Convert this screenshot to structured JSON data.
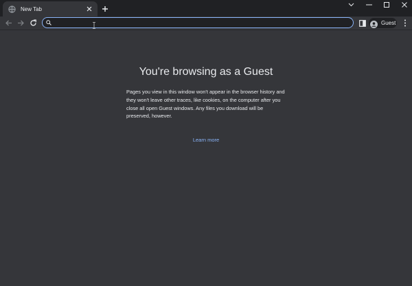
{
  "tab": {
    "title": "New Tab"
  },
  "omnibox": {
    "value": "",
    "placeholder": ""
  },
  "profile": {
    "label": "Guest"
  },
  "page": {
    "heading": "You're browsing as a Guest",
    "description": "Pages you view in this window won't appear in the browser history and they won't leave other traces, like cookies, on the computer after you close all open Guest windows. Any files you download will be preserved, however.",
    "learn_more": "Learn more"
  },
  "colors": {
    "accent": "#8ab4f8",
    "background": "#35363a",
    "frame": "#202124",
    "text": "#e8eaed"
  },
  "icons": [
    "globe-icon",
    "close-icon",
    "plus-icon",
    "chevron-down-icon",
    "minimize-icon",
    "maximize-icon",
    "close-window-icon",
    "back-icon",
    "forward-icon",
    "reload-icon",
    "search-icon",
    "text-cursor-icon",
    "side-panel-icon",
    "avatar-icon",
    "kebab-menu-icon"
  ]
}
